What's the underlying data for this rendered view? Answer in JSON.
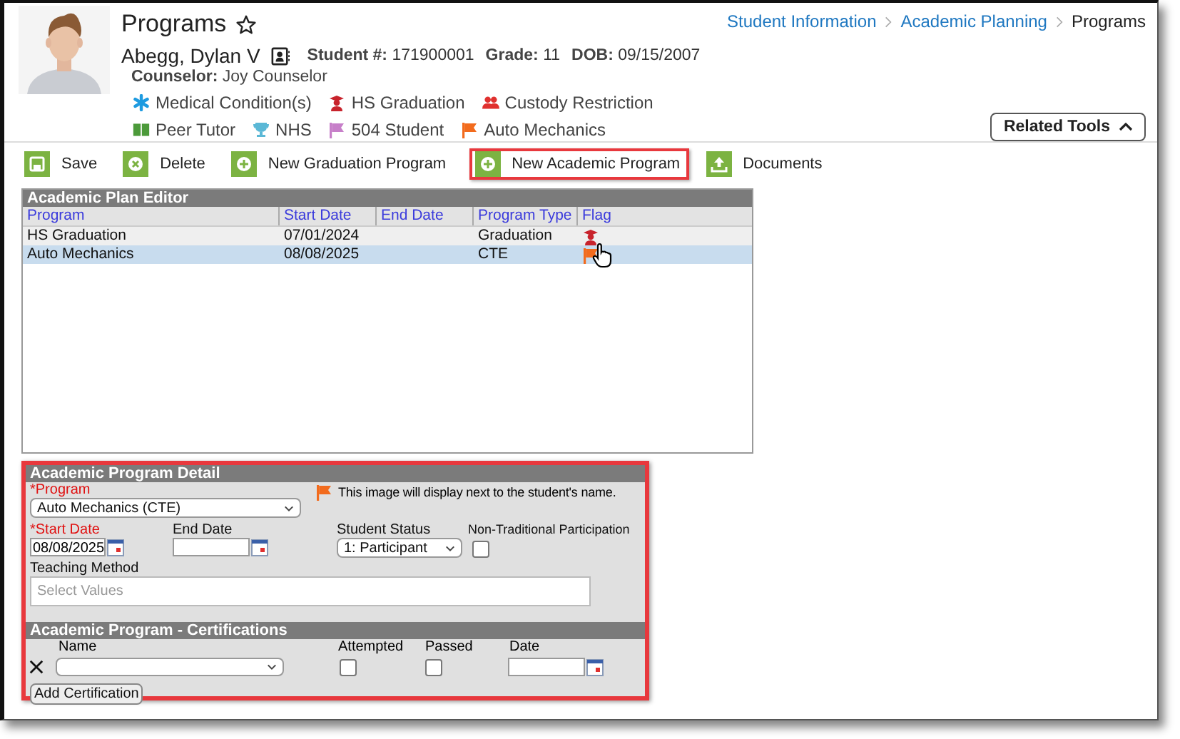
{
  "page": {
    "title": "Programs"
  },
  "breadcrumb": [
    {
      "label": "Student Information",
      "current": false
    },
    {
      "label": "Academic Planning",
      "current": false
    },
    {
      "label": "Programs",
      "current": true
    }
  ],
  "student": {
    "name": "Abegg, Dylan V",
    "fields": [
      {
        "label": "Student #:",
        "value": "171900001"
      },
      {
        "label": "Grade:",
        "value": "11"
      },
      {
        "label": "DOB:",
        "value": "09/15/2007"
      }
    ],
    "counselor_label": "Counselor:",
    "counselor": "Joy Counselor"
  },
  "flags": [
    {
      "kind": "asterisk",
      "label": "Medical Condition(s)",
      "color": "#1e9be0"
    },
    {
      "kind": "graduation",
      "label": "HS Graduation",
      "color": "#c8232c"
    },
    {
      "kind": "people",
      "label": "Custody Restriction",
      "color": "#e0312f"
    },
    {
      "kind": "book",
      "label": "Peer Tutor",
      "color": "#4c9a3a"
    },
    {
      "kind": "trophy",
      "label": "NHS",
      "color": "#5bb8d6"
    },
    {
      "kind": "flag",
      "label": "504 Student",
      "color": "#c77fc9"
    },
    {
      "kind": "flag",
      "label": "Auto Mechanics",
      "color": "#f26b1d"
    }
  ],
  "related_tools": {
    "label": "Related Tools"
  },
  "toolbar": [
    {
      "kind": "save",
      "label": "Save",
      "highlighted": false
    },
    {
      "kind": "delete",
      "label": "Delete",
      "highlighted": false
    },
    {
      "kind": "add",
      "label": "New Graduation Program",
      "highlighted": false
    },
    {
      "kind": "add",
      "label": "New Academic Program",
      "highlighted": true
    },
    {
      "kind": "upload",
      "label": "Documents",
      "highlighted": false
    }
  ],
  "editor": {
    "title": "Academic Plan Editor",
    "columns": [
      "Program",
      "Start Date",
      "End Date",
      "Program Type",
      "Flag"
    ],
    "rows": [
      {
        "cells": [
          "HS Graduation",
          "07/01/2024",
          "",
          "Graduation"
        ],
        "kind": "graduation",
        "color": "#c8232c",
        "selected": false
      },
      {
        "cells": [
          "Auto Mechanics",
          "08/08/2025",
          "",
          "CTE"
        ],
        "kind": "flag",
        "color": "#f26b1d",
        "selected": true
      }
    ]
  },
  "detail": {
    "title": "Academic Program Detail",
    "highlighted": true,
    "program": {
      "label": "*Program",
      "required": true,
      "value": "Auto Mechanics (CTE)"
    },
    "flag_note": "This image will display next to the student's name.",
    "start_date": {
      "label": "*Start Date",
      "required": true,
      "value": "08/08/2025"
    },
    "end_date": {
      "label": "End Date",
      "required": false
    },
    "student_status": {
      "label": "Student Status",
      "value": "1: Participant"
    },
    "non_traditional": {
      "label": "Non-Traditional Participation",
      "checked": false
    },
    "teaching_method": {
      "label": "Teaching Method",
      "placeholder": "Select Values"
    },
    "certifications": {
      "title": "Academic Program - Certifications",
      "columns": [
        "Name",
        "Attempted",
        "Passed",
        "Date"
      ],
      "rows": [
        {
          "attempted": false,
          "passed": false
        }
      ],
      "add_button": "Add Certification"
    }
  }
}
